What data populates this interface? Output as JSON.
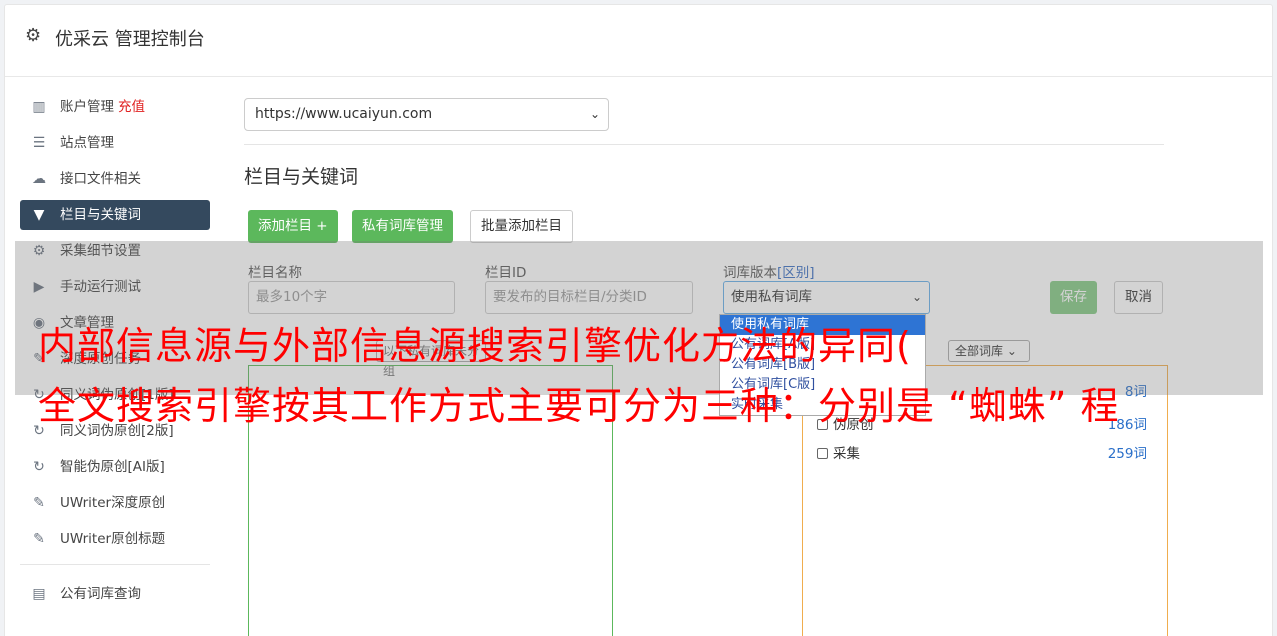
{
  "app": {
    "title": "优采云 管理控制台"
  },
  "sidebar": {
    "items": [
      {
        "label": "账户管理",
        "extra": "充值",
        "icon": "bar-chart-icon"
      },
      {
        "label": "站点管理",
        "icon": "server-icon"
      },
      {
        "label": "接口文件相关",
        "icon": "cloud-upload-icon"
      },
      {
        "label": "栏目与关键词",
        "icon": "filter-icon",
        "active": true
      },
      {
        "label": "采集细节设置",
        "icon": "gears-icon"
      },
      {
        "label": "手动运行测试",
        "icon": "play-circle-icon"
      },
      {
        "label": "文章管理",
        "icon": "database-icon"
      },
      {
        "label": "深度原创任务",
        "icon": "edit-icon"
      },
      {
        "label": "同义词伪原创[1版]",
        "icon": "refresh-icon"
      },
      {
        "label": "同义词伪原创[2版]",
        "icon": "refresh-icon"
      },
      {
        "label": "智能伪原创[AI版]",
        "icon": "refresh-icon"
      },
      {
        "label": "UWriter深度原创",
        "icon": "edit-icon"
      },
      {
        "label": "UWriter原创标题",
        "icon": "edit-icon"
      },
      {
        "label": "公有词库查询",
        "icon": "book-icon"
      }
    ]
  },
  "main": {
    "site_select": {
      "value": "https://www.ucaiyun.com"
    },
    "section_title": "栏目与关键词",
    "buttons": {
      "add_column": "添加栏目 +",
      "private_lib": "私有词库管理",
      "batch_add": "批量添加栏目"
    },
    "form": {
      "name_label": "栏目名称",
      "name_placeholder": "最多10个字",
      "id_label": "栏目ID",
      "id_placeholder": "要发布的目标栏目/分类ID",
      "lib_label": "词库版本",
      "lib_label_link": "[区别]",
      "lib_value": "使用私有词库",
      "save": "保存",
      "cancel": "取消"
    },
    "dropdown_options": [
      "使用私有词库",
      "公有词库[A版]",
      "公有词库[B版]",
      "公有词库[C版]",
      "实时采集"
    ],
    "left_box_header": "以下私有词库未分组",
    "right_select": "全部词库",
    "right_rows": [
      {
        "label": "伪原创",
        "count": "186词"
      },
      {
        "label": "采集",
        "count": "259词"
      }
    ],
    "right_partial_count": "8词"
  },
  "watermark": {
    "line1": "内部信息源与外部信息源搜索引擎优化方法的异同(",
    "line2": "全文搜索引擎按其工作方式主要可分为三种：分别是 “蜘蛛” 程"
  },
  "colors": {
    "active_bg": "#34495e",
    "green": "#5cb85c",
    "orange": "#f0ad4e",
    "link": "#2a6fc9",
    "watermark": "#ff0000"
  }
}
